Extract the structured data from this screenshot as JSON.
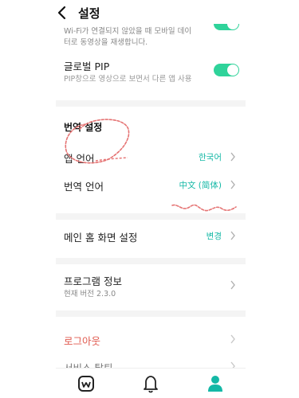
{
  "header": {
    "title": "설정"
  },
  "wifi_row": {
    "subtitle_line1": "Wi-Fi가 연결되지 않았을 때 모바일 데이",
    "subtitle_line2": "터로 동영상을 재생합니다."
  },
  "pip_row": {
    "title": "글로벌 PIP",
    "subtitle": "PIP창으로 영상으로 보면서 다른 앱 사용",
    "enabled": true
  },
  "translation": {
    "section_title": "번역 설정",
    "app_language_label": "앱 언어",
    "app_language_value": "한국어",
    "translation_language_label": "번역 언어",
    "translation_language_value": "中文 (简体)"
  },
  "home": {
    "label": "메인 홈 화면 설정",
    "value": "변경"
  },
  "program_info": {
    "label": "프로그램 정보",
    "version": "현재 버전 2.3.0"
  },
  "logout": {
    "label": "로그아웃"
  },
  "withdraw": {
    "label": "서비스 탈퇴"
  },
  "tabbar": {
    "tabs": [
      "home-icon",
      "bell-icon",
      "profile-icon"
    ],
    "active": "profile-icon"
  },
  "colors": {
    "accent": "#14b8a6",
    "toggle": "#2fd39a",
    "logout": "#e05a4f",
    "annotation": "#e57373"
  }
}
